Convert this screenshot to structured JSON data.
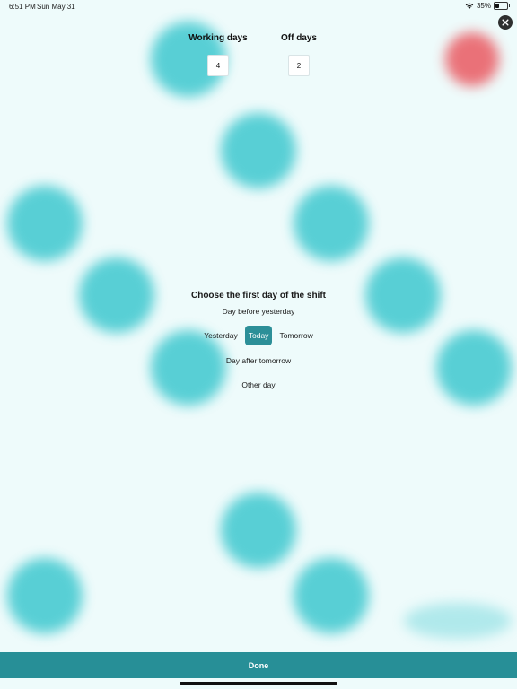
{
  "status_bar": {
    "time": "6:51 PM",
    "date": "Sun May 31",
    "battery": "35%"
  },
  "header": {
    "working_days_label": "Working days",
    "working_days_value": "4",
    "off_days_label": "Off days",
    "off_days_value": "2"
  },
  "shift": {
    "title": "Choose the first day of the shift",
    "options": {
      "day_before_yesterday": "Day before yesterday",
      "yesterday": "Yesterday",
      "today": "Today",
      "tomorrow": "Tomorrow",
      "day_after_tomorrow": "Day after tomorrow",
      "other_day": "Other day"
    },
    "selected": "Today"
  },
  "footer": {
    "done_label": "Done"
  },
  "colors": {
    "accent": "#278f97",
    "background": "#eefbfb",
    "blob": "#3fc8cf",
    "blob_red": "#ea5a62"
  },
  "icons": {
    "close": "close-icon",
    "wifi": "wifi-icon",
    "battery": "battery-icon"
  }
}
